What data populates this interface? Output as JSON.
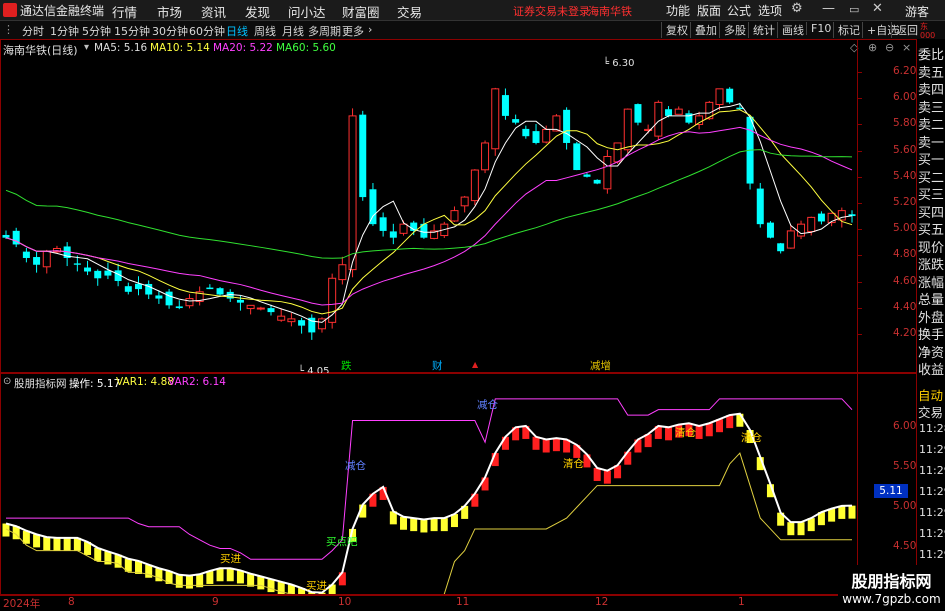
{
  "app": {
    "name": "通达信金融终端",
    "menus": [
      "行情",
      "市场",
      "资讯",
      "发现",
      "问小达",
      "财富圈",
      "交易"
    ],
    "warning": "证券交易未登录",
    "stock_link": "海南华铁",
    "right_menus": [
      "功能",
      "版面",
      "公式",
      "选项"
    ],
    "guest": "游客"
  },
  "toolbar": {
    "periods": [
      "分时",
      "1分钟",
      "5分钟",
      "15分钟",
      "30分钟",
      "60分钟",
      "日线",
      "周线",
      "月线",
      "多周期",
      "更多"
    ],
    "active_period": "日线",
    "right_buttons": [
      "复权",
      "叠加",
      "多股",
      "统计",
      "画线",
      "F10",
      "标记",
      "+自选",
      "返回"
    ]
  },
  "main_chart": {
    "title": "海南华铁(日线)",
    "ma_labels": [
      {
        "text": "MA5: 5.16",
        "color": "#ffffff"
      },
      {
        "text": "MA10: 5.14",
        "color": "#ffff40"
      },
      {
        "text": "MA20: 5.22",
        "color": "#ff40ff"
      },
      {
        "text": "MA60: 5.60",
        "color": "#40ff40"
      }
    ],
    "high_label": "6.30",
    "low_label": "4.05",
    "y_ticks": [
      "6.20",
      "6.00",
      "5.80",
      "5.60",
      "5.40",
      "5.20",
      "5.00",
      "4.80",
      "4.60",
      "4.40",
      "4.20"
    ],
    "events": [
      {
        "text": "跌",
        "color": "#00e000"
      },
      {
        "text": "财",
        "color": "#00b0ff"
      },
      {
        "text": "▲",
        "color": "#e02020"
      },
      {
        "text": "减增",
        "color": "#e0c000"
      }
    ]
  },
  "indicator": {
    "title": "股朋指标网",
    "op": "操作: 5.17",
    "var1": "VAR1: 4.88",
    "var2": "VAR2: 6.14",
    "y_ticks": [
      "6.00",
      "5.50",
      "5.00",
      "4.50"
    ],
    "current": "5.11",
    "annotations": [
      {
        "text": "减仓",
        "color": "#6080ff"
      },
      {
        "text": "减仓",
        "color": "#6080ff"
      },
      {
        "text": "清仓",
        "color": "#ffd000"
      },
      {
        "text": "清仓",
        "color": "#ffd000"
      },
      {
        "text": "清仓",
        "color": "#ffd000"
      },
      {
        "text": "买进",
        "color": "#ffd000"
      },
      {
        "text": "买进",
        "color": "#ffd000"
      },
      {
        "text": "买点吧",
        "color": "#30ff30"
      }
    ]
  },
  "right_panel": {
    "items": [
      "委比",
      "卖五",
      "卖四",
      "卖三",
      "卖二",
      "卖一",
      "买一",
      "买二",
      "买三",
      "买四",
      "买五",
      "现价",
      "涨跌",
      "涨幅",
      "总量",
      "外盘",
      "换手",
      "净资",
      "收益"
    ],
    "auto_label": "自动",
    "trade_label": "交易",
    "times": [
      "11:28",
      "11:29",
      "11:29",
      "11:29",
      "11:29",
      "11:29",
      "11:29",
      "11:29"
    ]
  },
  "x_axis": [
    "2024年",
    "8",
    "9",
    "10",
    "11",
    "12",
    "1"
  ],
  "watermark": {
    "line1": "股朋指标网",
    "line2": "www.7gpzb.com"
  },
  "chart_data": [
    {
      "type": "candlestick",
      "title": "海南华铁(日线)",
      "ylim": [
        4.05,
        6.3
      ],
      "close": [
        5.0,
        4.95,
        4.85,
        4.8,
        4.9,
        4.92,
        4.85,
        4.8,
        4.75,
        4.7,
        4.72,
        4.68,
        4.6,
        4.62,
        4.58,
        4.55,
        4.5,
        4.48,
        4.55,
        4.6,
        4.62,
        4.58,
        4.55,
        4.52,
        4.5,
        4.48,
        4.45,
        4.42,
        4.4,
        4.35,
        4.3,
        4.4,
        4.7,
        4.8,
        5.9,
        5.3,
        5.1,
        5.05,
        5.0,
        5.1,
        5.05,
        5.0,
        5.05,
        5.1,
        5.2,
        5.3,
        5.5,
        5.7,
        6.1,
        5.9,
        5.85,
        5.75,
        5.7,
        5.8,
        5.9,
        5.7,
        5.5,
        5.45,
        5.4,
        5.6,
        5.7,
        5.95,
        5.85,
        5.8,
        6.0,
        5.9,
        5.95,
        5.85,
        5.9,
        6.0,
        6.1,
        6.0,
        5.95,
        5.4,
        5.1,
        5.0,
        4.9,
        5.05,
        5.1,
        5.15,
        5.12,
        5.18,
        5.2,
        5.16
      ],
      "ma5_final": 5.16,
      "ma10_final": 5.14,
      "ma20_final": 5.22,
      "ma60_final": 5.6
    },
    {
      "type": "bar",
      "title": "股朋指标网",
      "op_final": 5.17,
      "var1_final": 4.88,
      "var2_final": 6.14,
      "ylim": [
        4.5,
        6.0
      ]
    }
  ]
}
